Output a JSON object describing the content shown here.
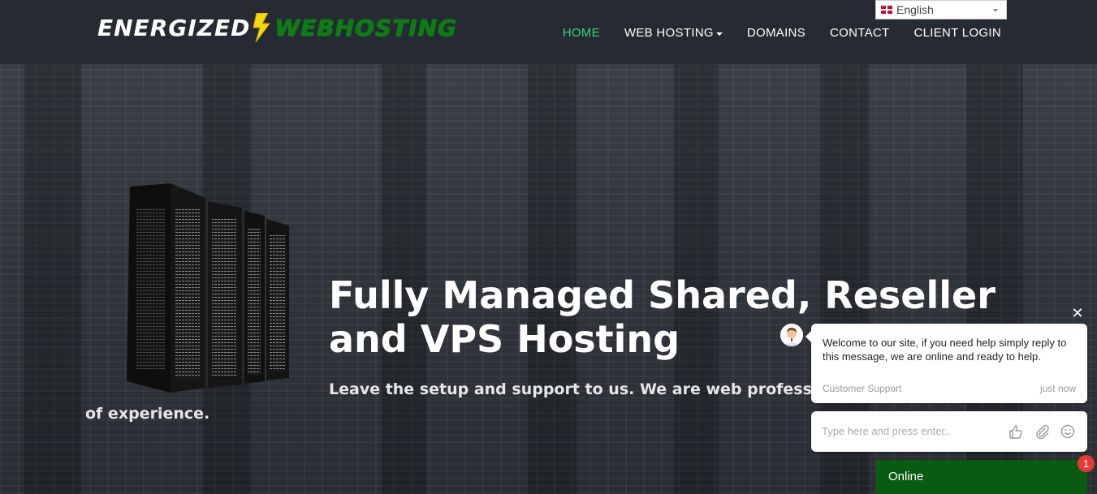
{
  "brand": {
    "name_part1": "ENERGIZED",
    "name_part2": "WEBHOSTING",
    "part1_color": "#ffffff",
    "part2_color": "#0b7d12",
    "bolt_color": "#f5d90a"
  },
  "nav": {
    "items": [
      {
        "label": "HOME",
        "active": true
      },
      {
        "label": "WEB HOSTING",
        "dropdown": true
      },
      {
        "label": "DOMAINS"
      },
      {
        "label": "CONTACT"
      },
      {
        "label": "CLIENT LOGIN"
      }
    ],
    "active_color": "#3ed07b"
  },
  "language": {
    "selected": "English",
    "icon": "uk-flag-icon"
  },
  "hero": {
    "heading": "Fully Managed Shared, Reseller and VPS Hosting",
    "subtext_line1": "Leave the setup and support to us. We are web professi",
    "subtext_line2": "of experience."
  },
  "chat": {
    "message": "Welcome to our site, if you need help simply reply to this message, we are online and ready to help.",
    "sender": "Customer Support",
    "time": "just now",
    "input_placeholder": "Type here and press enter..",
    "status": "Online",
    "unread_count": "1",
    "status_color": "#0a5b12",
    "icons": [
      "close-icon",
      "thumbs-up-icon",
      "paperclip-icon",
      "smiley-icon"
    ]
  }
}
